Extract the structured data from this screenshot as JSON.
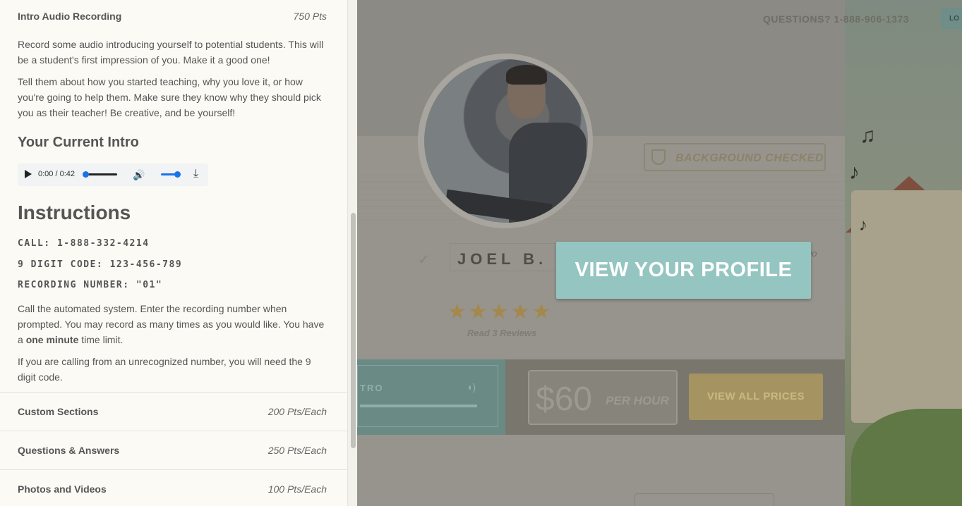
{
  "panel": {
    "intro_section": {
      "title": "Intro Audio Recording",
      "points": "750 Pts"
    },
    "intro_p1": "Record some audio introducing yourself to potential students. This will be a student's first impression of you. Make it a good one!",
    "intro_p2": "Tell them about how you started teaching, why you love it, or how you're going to help them. Make sure they know why they should pick you as their teacher! Be creative, and be yourself!",
    "current_intro_heading": "Your Current Intro",
    "audio": {
      "time": "0:00 / 0:42",
      "progress": 0.0,
      "volume": 1.0
    },
    "instructions_heading": "Instructions",
    "call": "CALL: 1-888-332-4214",
    "code": "9 DIGIT CODE: 123-456-789",
    "recording_number": "RECORDING NUMBER: \"01\"",
    "instr_p1_before": "Call the automated system. Enter the recording number when prompted. You may record as many times as you would like. You have a ",
    "instr_p1_bold": "one minute",
    "instr_p1_after": " time limit.",
    "instr_p2": "If you are calling from an unrecognized number, you will need the 9 digit code.",
    "sections": [
      {
        "title": "Custom Sections",
        "points": "200 Pts/Each"
      },
      {
        "title": "Questions & Answers",
        "points": "250 Pts/Each"
      },
      {
        "title": "Photos and Videos",
        "points": "100 Pts/Each"
      }
    ]
  },
  "preview": {
    "questions": "QUESTIONS? 1-888-906-1373",
    "login": "LO",
    "background_checked": "BACKGROUND CHECKED",
    "name": "JOEL B.",
    "faint_go": "go",
    "rating_stars": 5,
    "stars_text": "★★★★★",
    "reviews": "Read 3 Reviews",
    "cta": "VIEW YOUR PROFILE",
    "intro_label": "TRO",
    "price": "$60",
    "per_hour": "PER HOUR",
    "view_all_prices": "VIEW ALL PRICES"
  },
  "colors": {
    "cta": "#94c5c1",
    "panel_bg": "#fbfaf4",
    "overlay": "#8c8a84"
  }
}
